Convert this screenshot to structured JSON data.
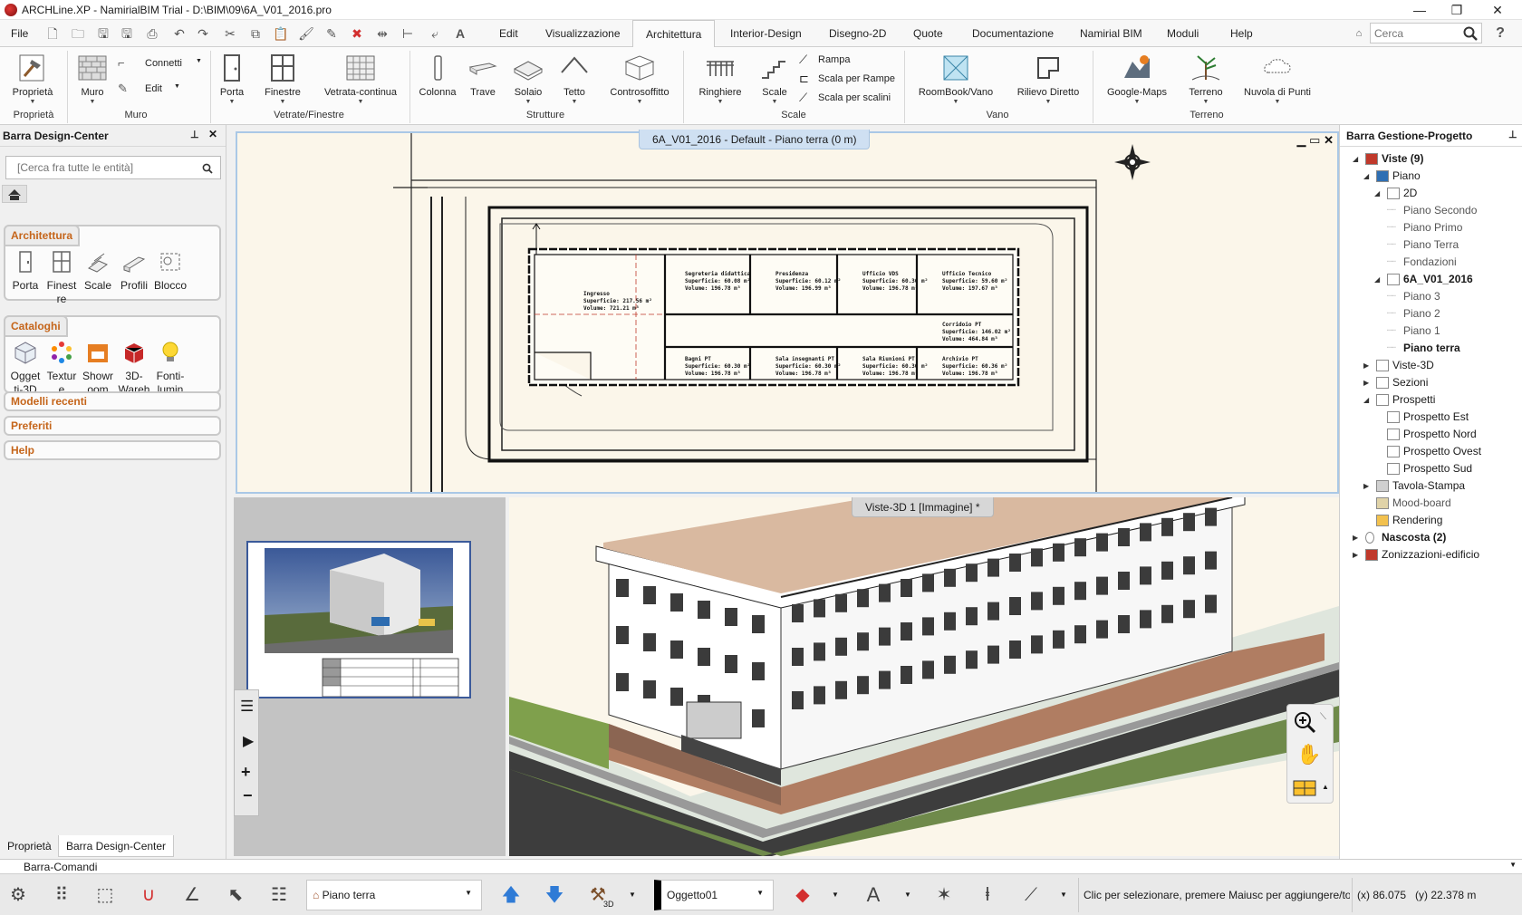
{
  "window": {
    "title": "ARCHLine.XP - NamirialBIM Trial - D:\\BIM\\09\\6A_V01_2016.pro",
    "minimize": "—",
    "maximize": "❐",
    "close": "✕"
  },
  "menu": {
    "file": "File",
    "tabs": [
      "Edit",
      "Visualizzazione",
      "Architettura",
      "Interior-Design",
      "Disegno-2D",
      "Quote",
      "Documentazione",
      "Namirial BIM",
      "Moduli",
      "Help"
    ],
    "search_placeholder": "Cerca",
    "help": "?"
  },
  "ribbon": {
    "proprieta": "Proprietà",
    "muro": "Muro",
    "connetti": "Connetti",
    "edit": "Edit",
    "porta": "Porta",
    "finestre": "Finestre",
    "vetrata": "Vetrata-continua",
    "colonna": "Colonna",
    "trave": "Trave",
    "solaio": "Solaio",
    "tetto": "Tetto",
    "controsoffitto": "Controsoffitto",
    "ringhiere": "Ringhiere",
    "scale": "Scale",
    "rampa": "Rampa",
    "scala_rampe": "Scala per Rampe",
    "scala_scalini": "Scala per scalini",
    "roombook": "RoomBook/Vano",
    "rilievo": "Rilievo Diretto",
    "google_maps": "Google-Maps",
    "terreno": "Terreno",
    "nuvola": "Nuvola di Punti",
    "groups": {
      "proprieta": "Proprietà",
      "muro": "Muro",
      "vetrate": "Vetrate/Finestre",
      "strutture": "Strutture",
      "scale": "Scale",
      "vano": "Vano",
      "terreno": "Terreno"
    }
  },
  "left_panel": {
    "title": "Barra Design-Center",
    "search_placeholder": "[Cerca fra tutte le entità]",
    "architettura": {
      "title": "Architettura",
      "items": [
        "Porta",
        "Finest re",
        "Scale",
        "Profili",
        "Blocco"
      ]
    },
    "cataloghi": {
      "title": "Cataloghi",
      "items": [
        "Ogget ti-3D",
        "Textur e",
        "Showr oom",
        "3D-Wareh",
        "Fonti-lumin"
      ]
    },
    "collapsed": [
      "Modelli recenti",
      "Preferiti",
      "Help"
    ],
    "bottom_tabs": [
      "Proprietà",
      "Barra Design-Center"
    ]
  },
  "right_panel": {
    "title": "Barra Gestione-Progetto",
    "tree": {
      "viste": "Viste (9)",
      "piano": "Piano",
      "twod": "2D",
      "piani_2d": [
        "Piano Secondo",
        "Piano Primo",
        "Piano Terra",
        "Fondazioni"
      ],
      "model": "6A_V01_2016",
      "piani_model": [
        "Piano 3",
        "Piano 2",
        "Piano 1",
        "Piano terra"
      ],
      "viste3d": "Viste-3D",
      "sezioni": "Sezioni",
      "prospetti": "Prospetti",
      "prospetti_items": [
        "Prospetto Est",
        "Prospetto Nord",
        "Prospetto Ovest",
        "Prospetto Sud"
      ],
      "tavola": "Tavola-Stampa",
      "mood": "Mood-board",
      "rendering": "Rendering",
      "nascosta": "Nascosta (2)",
      "zonizzazioni": "Zonizzazioni-edificio"
    }
  },
  "plan_view": {
    "tab": "6A_V01_2016 - Default - Piano terra (0 m)",
    "rooms": [
      {
        "name": "Ingresso",
        "sup": "Superficie: 217.56 m²",
        "vol": "Volume: 721.21 m³"
      },
      {
        "name": "Segreteria didattica",
        "sup": "Superficie: 60.08 m²",
        "vol": "Volume: 196.78 m³"
      },
      {
        "name": "Presidenza",
        "sup": "Superficie: 60.12 m²",
        "vol": "Volume: 196.99 m³"
      },
      {
        "name": "Ufficio VDS",
        "sup": "Superficie: 60.30 m²",
        "vol": "Volume: 196.78 m³"
      },
      {
        "name": "Ufficio Tecnico",
        "sup": "Superficie: 59.60 m²",
        "vol": "Volume: 197.67 m³"
      },
      {
        "name": "Corridoio PT",
        "sup": "Superficie: 146.02 m²",
        "vol": "Volume: 464.84 m³"
      },
      {
        "name": "Bagni PT",
        "sup": "Superficie: 60.30 m²",
        "vol": "Volume: 196.78 m³"
      },
      {
        "name": "Sala insegnanti PT",
        "sup": "Superficie: 60.30 m²",
        "vol": "Volume: 196.78 m³"
      },
      {
        "name": "Sala Riunioni PT",
        "sup": "Superficie: 60.30 m²",
        "vol": "Volume: 196.78 m³"
      },
      {
        "name": "Archivio PT",
        "sup": "Superficie: 60.36 m²",
        "vol": "Volume: 196.78 m³"
      }
    ]
  },
  "view3d": {
    "tab": "Viste-3D 1 [Immagine] *"
  },
  "command_bar": "Barra-Comandi",
  "status": {
    "floor": "Piano terra",
    "object": "Oggetto01",
    "hint": "Clic per selezionare, premere Maiusc per aggiungere/to",
    "coords": "(x) 86.075   (y) 22.378 m",
    "hammer_label": "3D"
  },
  "colors": {
    "accent_orange": "#c5651a",
    "tab_blue": "#cfe0f2",
    "selection_border": "#aac8e6",
    "roof": "#d9b9a0"
  }
}
